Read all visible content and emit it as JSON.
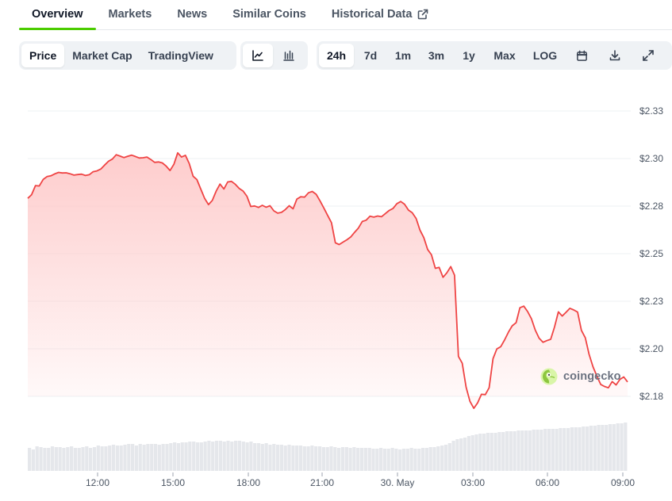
{
  "tabs": [
    {
      "label": "Overview",
      "active": true
    },
    {
      "label": "Markets",
      "active": false
    },
    {
      "label": "News",
      "active": false
    },
    {
      "label": "Similar Coins",
      "active": false
    },
    {
      "label": "Historical Data",
      "active": false,
      "icon": "external-link-icon"
    }
  ],
  "toolbar": {
    "metric_tabs": [
      "Price",
      "Market Cap",
      "TradingView"
    ],
    "metric_active": "Price",
    "chart_type_icons": [
      "line-chart-icon",
      "candlestick-icon"
    ],
    "chart_type_active": "line-chart-icon",
    "ranges": [
      "24h",
      "7d",
      "1m",
      "3m",
      "1y",
      "Max",
      "LOG"
    ],
    "range_active": "24h",
    "action_icons": [
      "calendar-icon",
      "download-icon",
      "fullscreen-icon"
    ]
  },
  "watermark": {
    "text": "coingecko",
    "icon": "coingecko-logo-icon"
  },
  "colors": {
    "line": "#ef4444",
    "fill_top": "#fecaca",
    "accent": "#4bcc00",
    "volume": "#e5e7eb",
    "grid": "#eef0f3"
  },
  "chart_data": {
    "type": "area",
    "title": "",
    "xlabel": "",
    "ylabel": "",
    "x_tick_labels": [
      "12:00",
      "15:00",
      "18:00",
      "21:00",
      "30. May",
      "03:00",
      "06:00",
      "09:00"
    ],
    "y_tick_labels": [
      "$2.33",
      "$2.30",
      "$2.28",
      "$2.25",
      "$2.23",
      "$2.20",
      "$2.18"
    ],
    "ylim": [
      2.175,
      2.335
    ],
    "grid": true,
    "legend": "none",
    "series": [
      {
        "values": [
          2.2791,
          2.281,
          2.2858,
          2.2856,
          2.289,
          2.2905,
          2.2909,
          2.2919,
          2.2927,
          2.2924,
          2.2925,
          2.292,
          2.2913,
          2.2916,
          2.2918,
          2.2911,
          2.2915,
          2.2931,
          2.2935,
          2.2945,
          2.2966,
          2.2986,
          2.2997,
          2.302,
          2.3013,
          2.3005,
          2.3012,
          2.3018,
          2.3011,
          2.3003,
          2.3004,
          2.3008,
          2.2995,
          2.298,
          2.2982,
          2.2977,
          2.296,
          2.2937,
          2.297,
          2.303,
          2.3008,
          2.3017,
          2.2974,
          2.2907,
          2.2889,
          2.2839,
          2.2791,
          2.2758,
          2.278,
          2.2829,
          2.2866,
          2.284,
          2.2877,
          2.288,
          2.2864,
          2.2843,
          2.2829,
          2.2802,
          2.2748,
          2.2751,
          2.2743,
          2.2754,
          2.2744,
          2.2752,
          2.2725,
          2.2713,
          2.2717,
          2.2732,
          2.2752,
          2.2736,
          2.2787,
          2.2799,
          2.2797,
          2.282,
          2.2827,
          2.2812,
          2.2778,
          2.274,
          2.2701,
          2.2663,
          2.2557,
          2.2548,
          2.2561,
          2.2573,
          2.2588,
          2.2612,
          2.2635,
          2.2669,
          2.2676,
          2.2697,
          2.2692,
          2.2698,
          2.2694,
          2.2711,
          2.2727,
          2.2738,
          2.2763,
          2.2774,
          2.276,
          2.2729,
          2.2715,
          2.2685,
          2.2624,
          2.2584,
          2.2522,
          2.2494,
          2.2423,
          2.2428,
          2.2376,
          2.2399,
          2.2432,
          2.2387,
          2.196,
          2.1924,
          2.1798,
          2.1724,
          2.1687,
          2.1716,
          2.1761,
          2.1759,
          2.1795,
          2.1948,
          2.1999,
          2.2011,
          2.2046,
          2.2087,
          2.2121,
          2.2137,
          2.2216,
          2.2224,
          2.2196,
          2.2158,
          2.2098,
          2.2056,
          2.2034,
          2.2043,
          2.205,
          2.2114,
          2.2194,
          2.2172,
          2.2192,
          2.2213,
          2.2204,
          2.2193,
          2.2097,
          2.2058,
          2.1971,
          2.1906,
          2.1858,
          2.1813,
          2.1802,
          2.1795,
          2.1828,
          2.181,
          2.1839,
          2.1852,
          2.1826
        ]
      }
    ],
    "volume": [
      0.29,
      0.27,
      0.31,
      0.3,
      0.29,
      0.29,
      0.31,
      0.3,
      0.3,
      0.29,
      0.3,
      0.31,
      0.29,
      0.29,
      0.3,
      0.31,
      0.29,
      0.3,
      0.32,
      0.31,
      0.31,
      0.32,
      0.33,
      0.32,
      0.32,
      0.33,
      0.34,
      0.34,
      0.32,
      0.34,
      0.33,
      0.34,
      0.34,
      0.34,
      0.33,
      0.34,
      0.34,
      0.35,
      0.36,
      0.35,
      0.36,
      0.36,
      0.37,
      0.37,
      0.36,
      0.36,
      0.37,
      0.38,
      0.37,
      0.38,
      0.38,
      0.37,
      0.38,
      0.37,
      0.38,
      0.38,
      0.37,
      0.36,
      0.37,
      0.35,
      0.35,
      0.34,
      0.35,
      0.33,
      0.34,
      0.33,
      0.33,
      0.32,
      0.33,
      0.32,
      0.32,
      0.32,
      0.31,
      0.31,
      0.32,
      0.31,
      0.31,
      0.3,
      0.3,
      0.31,
      0.3,
      0.29,
      0.3,
      0.3,
      0.29,
      0.3,
      0.29,
      0.29,
      0.29,
      0.29,
      0.28,
      0.28,
      0.29,
      0.28,
      0.28,
      0.29,
      0.28,
      0.27,
      0.28,
      0.28,
      0.29,
      0.28,
      0.28,
      0.29,
      0.29,
      0.3,
      0.3,
      0.31,
      0.32,
      0.33,
      0.35,
      0.38,
      0.4,
      0.41,
      0.42,
      0.44,
      0.45,
      0.46,
      0.47,
      0.47,
      0.48,
      0.48,
      0.48,
      0.49,
      0.49,
      0.5,
      0.5,
      0.5,
      0.51,
      0.51,
      0.51,
      0.51,
      0.52,
      0.52,
      0.52,
      0.53,
      0.53,
      0.53,
      0.53,
      0.54,
      0.54,
      0.54,
      0.55,
      0.55,
      0.55,
      0.56,
      0.56,
      0.57,
      0.57,
      0.58,
      0.58,
      0.58,
      0.59,
      0.59,
      0.6,
      0.6,
      0.61
    ]
  }
}
